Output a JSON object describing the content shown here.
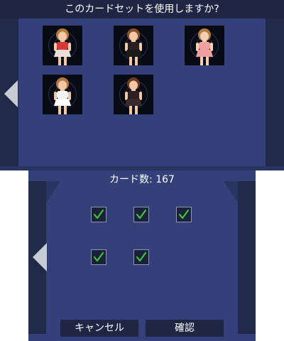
{
  "top_screen": {
    "title": "このカードセットを使用しますか?",
    "cards": [
      {
        "name": "card-red-outfit",
        "hair": "#b57a3f",
        "top": "#d63a3a",
        "bottom": "#e8e0d8",
        "skin": "#f1c9a8"
      },
      {
        "name": "card-black-outfit",
        "hair": "#8a4f2a",
        "top": "#2a1e22",
        "bottom": "#1a1a1a",
        "skin": "#f1c9a8"
      },
      {
        "name": "card-swimsuit",
        "hair": "#b57a3f",
        "top": "#f0a0a0",
        "bottom": "#f0a0a0",
        "skin": "#f4cfb0"
      },
      {
        "name": "card-white-frill",
        "hair": "#b57a3f",
        "top": "#f2f2f2",
        "bottom": "#ffffff",
        "skin": "#f1c9a8"
      },
      {
        "name": "card-dark-dress",
        "hair": "#6e3a20",
        "top": "#2b2024",
        "bottom": "#3a2a2e",
        "skin": "#f1c9a8"
      }
    ]
  },
  "bottom_screen": {
    "card_count_label": "カード数: 167",
    "checkboxes": [
      {
        "checked": true
      },
      {
        "checked": true
      },
      {
        "checked": true
      },
      {
        "checked": true
      },
      {
        "checked": true
      }
    ],
    "cancel_label": "キャンセル",
    "confirm_label": "確認"
  },
  "colors": {
    "panel_bg": "#34407a",
    "dark_bar": "#1f2644",
    "check_green": "#3cc43c",
    "arrow": "#c9cbd4"
  }
}
